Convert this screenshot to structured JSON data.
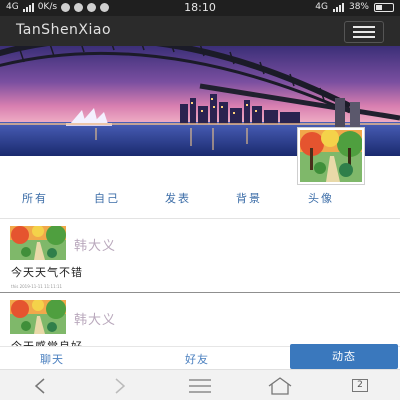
{
  "status_bar": {
    "network": "4G",
    "speed": "0K/s",
    "time": "18:10",
    "network_right": "4G",
    "battery": "38%"
  },
  "app": {
    "title": "TanShenXiao"
  },
  "tabs": [
    "所有",
    "自己",
    "发表",
    "背景",
    "头像"
  ],
  "posts": [
    {
      "name": "韩大义",
      "text": "今天天气不错",
      "meta": "this    2019-11-11 11:11:11"
    },
    {
      "name": "韩大义",
      "text": "今天感觉良好"
    }
  ],
  "bottom_nav": {
    "chat": "聊天",
    "friends": "好友",
    "moments": "动态"
  },
  "system_nav": {
    "tab_count": "2"
  },
  "colors": {
    "app_bar": "#2b2b2b",
    "tab_text": "#3d6ea8",
    "active_nav": "#3a78bd",
    "post_name": "#b9a8bc"
  }
}
